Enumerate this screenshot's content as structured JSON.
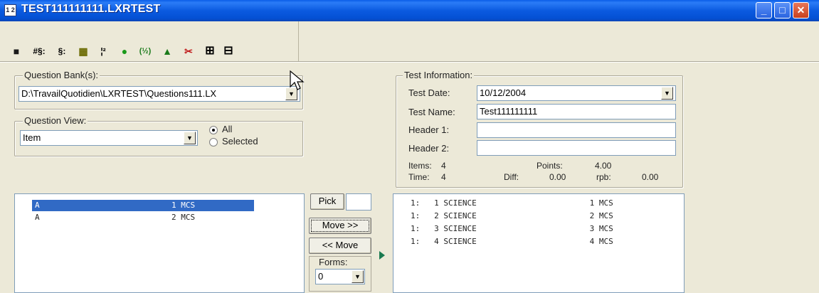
{
  "window": {
    "title": "TEST111111111.LXRTEST",
    "icon_label": "1 2"
  },
  "toolbar": {
    "items": [
      "save-icon",
      "renumber-icon",
      "section-icon",
      "bank-icon",
      "superscript-icon",
      "clock-icon",
      "half-icon",
      "lock-icon",
      "scissors-icon",
      "expand-icon",
      "collapse-icon"
    ],
    "glyphs": [
      "■",
      "#§:",
      "§:",
      "▦",
      "¦²",
      "●",
      "(½)",
      "▲",
      "✂",
      "⊞",
      "⊟"
    ]
  },
  "question_bank": {
    "legend": "Question Bank(s):",
    "value": "D:\\TravailQuotidien\\LXRTEST\\Questions111.LX"
  },
  "question_view": {
    "legend": "Question View:",
    "value": "Item",
    "radio_all": "All",
    "radio_selected": "Selected"
  },
  "test_info": {
    "legend": "Test Information:",
    "test_date_label": "Test Date:",
    "test_date_value": "10/12/2004",
    "test_name_label": "Test Name:",
    "test_name_value": "Test111111111",
    "header1_label": "Header 1:",
    "header1_value": "",
    "header2_label": "Header 2:",
    "header2_value": "",
    "items_label": "Items:",
    "items_value": "4",
    "points_label": "Points:",
    "points_value": "4.00",
    "time_label": "Time:",
    "time_value": "4",
    "diff_label": "Diff:",
    "diff_value": "0.00",
    "rpb_label": "rpb:",
    "rpb_value": "0.00"
  },
  "left_list": {
    "rows": [
      {
        "text": "A                            1 MCS",
        "selected": true
      },
      {
        "text": "A                            2 MCS",
        "selected": false
      }
    ]
  },
  "middle": {
    "pick_label": "Pick",
    "pick_value": "",
    "move_right_label": "Move >>",
    "move_left_label": "<< Move",
    "forms_label": "Forms:",
    "forms_value": "0"
  },
  "right_list": {
    "rows": [
      "1:   1 SCIENCE                        1 MCS",
      "1:   2 SCIENCE                        2 MCS",
      "1:   3 SCIENCE                        3 MCS",
      "1:   4 SCIENCE                        4 MCS"
    ]
  },
  "colors": {
    "selection": "#316ac5",
    "titlebar": "#0a5de8",
    "window_bg": "#ece9d8"
  }
}
